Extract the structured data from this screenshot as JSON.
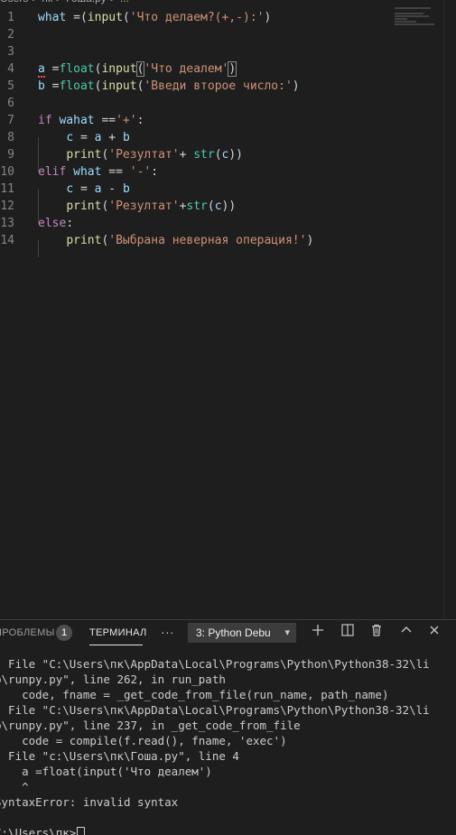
{
  "breadcrumb": [
    "Users",
    ">",
    "пк",
    ">",
    "Гоша.py",
    ">",
    "..."
  ],
  "editor": {
    "lines": [
      {
        "n": "1",
        "code": [
          {
            "t": "what",
            "c": "var"
          },
          {
            "t": " =(",
            "c": "punc"
          },
          {
            "t": "input",
            "c": "fn"
          },
          {
            "t": "(",
            "c": "punc"
          },
          {
            "t": "'Что делаем?(+,-):'",
            "c": "str"
          },
          {
            "t": ")",
            "c": "punc"
          }
        ]
      },
      {
        "n": "2",
        "code": []
      },
      {
        "n": "3",
        "code": []
      },
      {
        "n": "4",
        "code": [
          {
            "t": "a",
            "c": "var squiggle"
          },
          {
            "t": " =",
            "c": "punc"
          },
          {
            "t": "float",
            "c": "bi"
          },
          {
            "t": "(",
            "c": "punc"
          },
          {
            "t": "input",
            "c": "fn"
          },
          {
            "t": "(",
            "c": "punc bracket-hl"
          },
          {
            "t": "'Что деалем'",
            "c": "str"
          },
          {
            "t": ")",
            "c": "punc bracket-hl"
          }
        ]
      },
      {
        "n": "5",
        "code": [
          {
            "t": "b",
            "c": "var"
          },
          {
            "t": " =",
            "c": "punc"
          },
          {
            "t": "float",
            "c": "bi"
          },
          {
            "t": "(",
            "c": "punc"
          },
          {
            "t": "input",
            "c": "fn"
          },
          {
            "t": "(",
            "c": "punc"
          },
          {
            "t": "'Введи второе число:'",
            "c": "str"
          },
          {
            "t": ")",
            "c": "punc"
          }
        ]
      },
      {
        "n": "6",
        "code": []
      },
      {
        "n": "7",
        "code": [
          {
            "t": "if",
            "c": "kw"
          },
          {
            "t": " ",
            "c": "punc"
          },
          {
            "t": "wahat",
            "c": "var"
          },
          {
            "t": " ==",
            "c": "punc"
          },
          {
            "t": "'+'",
            "c": "str"
          },
          {
            "t": ":",
            "c": "punc"
          }
        ]
      },
      {
        "n": "8",
        "code": [
          {
            "t": "    ",
            "c": "punc"
          },
          {
            "t": "c",
            "c": "var"
          },
          {
            "t": " = ",
            "c": "punc"
          },
          {
            "t": "a",
            "c": "var"
          },
          {
            "t": " + ",
            "c": "punc"
          },
          {
            "t": "b",
            "c": "var"
          }
        ]
      },
      {
        "n": "9",
        "code": [
          {
            "t": "    ",
            "c": "punc"
          },
          {
            "t": "print",
            "c": "fn"
          },
          {
            "t": "(",
            "c": "punc"
          },
          {
            "t": "'Резултат'",
            "c": "str"
          },
          {
            "t": "+ ",
            "c": "punc"
          },
          {
            "t": "str",
            "c": "bi"
          },
          {
            "t": "(",
            "c": "punc"
          },
          {
            "t": "c",
            "c": "var"
          },
          {
            "t": "))",
            "c": "punc"
          }
        ]
      },
      {
        "n": "10",
        "code": [
          {
            "t": "elif",
            "c": "kw"
          },
          {
            "t": " ",
            "c": "punc"
          },
          {
            "t": "what",
            "c": "var"
          },
          {
            "t": " == ",
            "c": "punc"
          },
          {
            "t": "'-'",
            "c": "str"
          },
          {
            "t": ":",
            "c": "punc"
          }
        ]
      },
      {
        "n": "11",
        "code": [
          {
            "t": "    ",
            "c": "punc"
          },
          {
            "t": "c",
            "c": "var"
          },
          {
            "t": " = ",
            "c": "punc"
          },
          {
            "t": "a",
            "c": "var"
          },
          {
            "t": " - ",
            "c": "punc"
          },
          {
            "t": "b",
            "c": "var"
          }
        ]
      },
      {
        "n": "12",
        "code": [
          {
            "t": "    ",
            "c": "punc"
          },
          {
            "t": "print",
            "c": "fn"
          },
          {
            "t": "(",
            "c": "punc"
          },
          {
            "t": "'Резултат'",
            "c": "str"
          },
          {
            "t": "+",
            "c": "punc"
          },
          {
            "t": "str",
            "c": "bi"
          },
          {
            "t": "(",
            "c": "punc"
          },
          {
            "t": "c",
            "c": "var"
          },
          {
            "t": "))",
            "c": "punc"
          }
        ]
      },
      {
        "n": "13",
        "code": [
          {
            "t": "else",
            "c": "kw"
          },
          {
            "t": ":",
            "c": "punc"
          }
        ]
      },
      {
        "n": "14",
        "code": [
          {
            "t": "    ",
            "c": "punc"
          },
          {
            "t": "print",
            "c": "fn"
          },
          {
            "t": "(",
            "c": "punc"
          },
          {
            "t": "'Выбрана неверная операция!'",
            "c": "str"
          },
          {
            "t": ")",
            "c": "punc"
          }
        ]
      }
    ]
  },
  "panel": {
    "tab_problems": "ПРОБЛЕМЫ",
    "problems_count": "1",
    "tab_terminal": "ТЕРМИНАЛ",
    "more_label": "···",
    "terminal_select": "3: Python Debu",
    "icons": [
      "plus-icon",
      "split-icon",
      "trash-icon",
      "chevron-up-icon",
      "close-icon"
    ]
  },
  "terminal": {
    "lines": [
      "  File \"C:\\Users\\пк\\AppData\\Local\\Programs\\Python\\Python38-32\\li",
      "b\\runpy.py\", line 262, in run_path",
      "    code, fname = _get_code_from_file(run_name, path_name)",
      "  File \"C:\\Users\\пк\\AppData\\Local\\Programs\\Python\\Python38-32\\li",
      "b\\runpy.py\", line 237, in _get_code_from_file",
      "    code = compile(f.read(), fname, 'exec')",
      "  File \"c:\\Users\\пк\\Гоша.py\", line 4",
      "    a =float(input('Что деалем')",
      "    ^",
      "SyntaxError: invalid syntax",
      "",
      "C:\\Users\\пк>"
    ]
  }
}
